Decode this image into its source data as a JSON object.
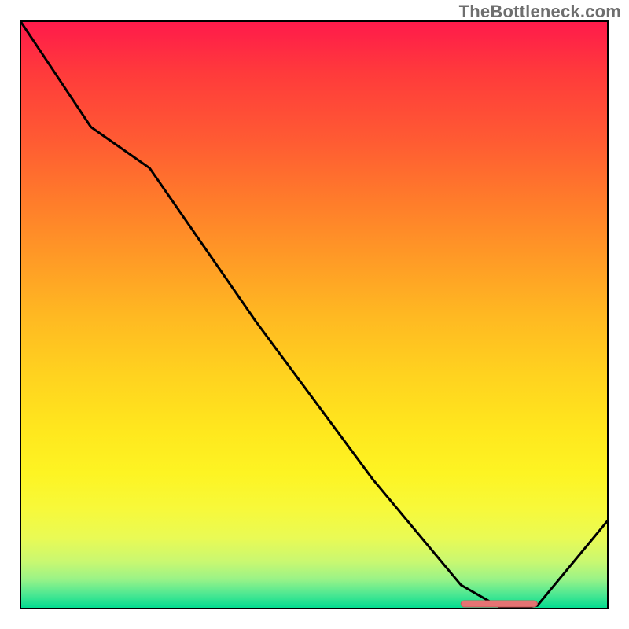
{
  "watermark": "TheBottleneck.com",
  "chart_data": {
    "type": "line",
    "title": "",
    "xlabel": "",
    "ylabel": "",
    "xlim": [
      0,
      100
    ],
    "ylim": [
      0,
      100
    ],
    "grid": false,
    "x": [
      0,
      4,
      12,
      22,
      40,
      60,
      75,
      82,
      85,
      88,
      100
    ],
    "values": [
      100,
      94,
      82,
      75,
      49,
      22,
      4,
      0,
      0,
      0.5,
      15
    ],
    "optimal_range_x": [
      75,
      88
    ],
    "marker": {
      "x_start": 75,
      "x_end": 88,
      "y": 0.8
    },
    "background": "rainbow-vertical-gradient"
  },
  "colors": {
    "curve": "#000000",
    "border": "#000000",
    "marker_fill": "#e57373",
    "marker_stroke": "#c75a5a",
    "watermark": "#6e6e6e"
  }
}
